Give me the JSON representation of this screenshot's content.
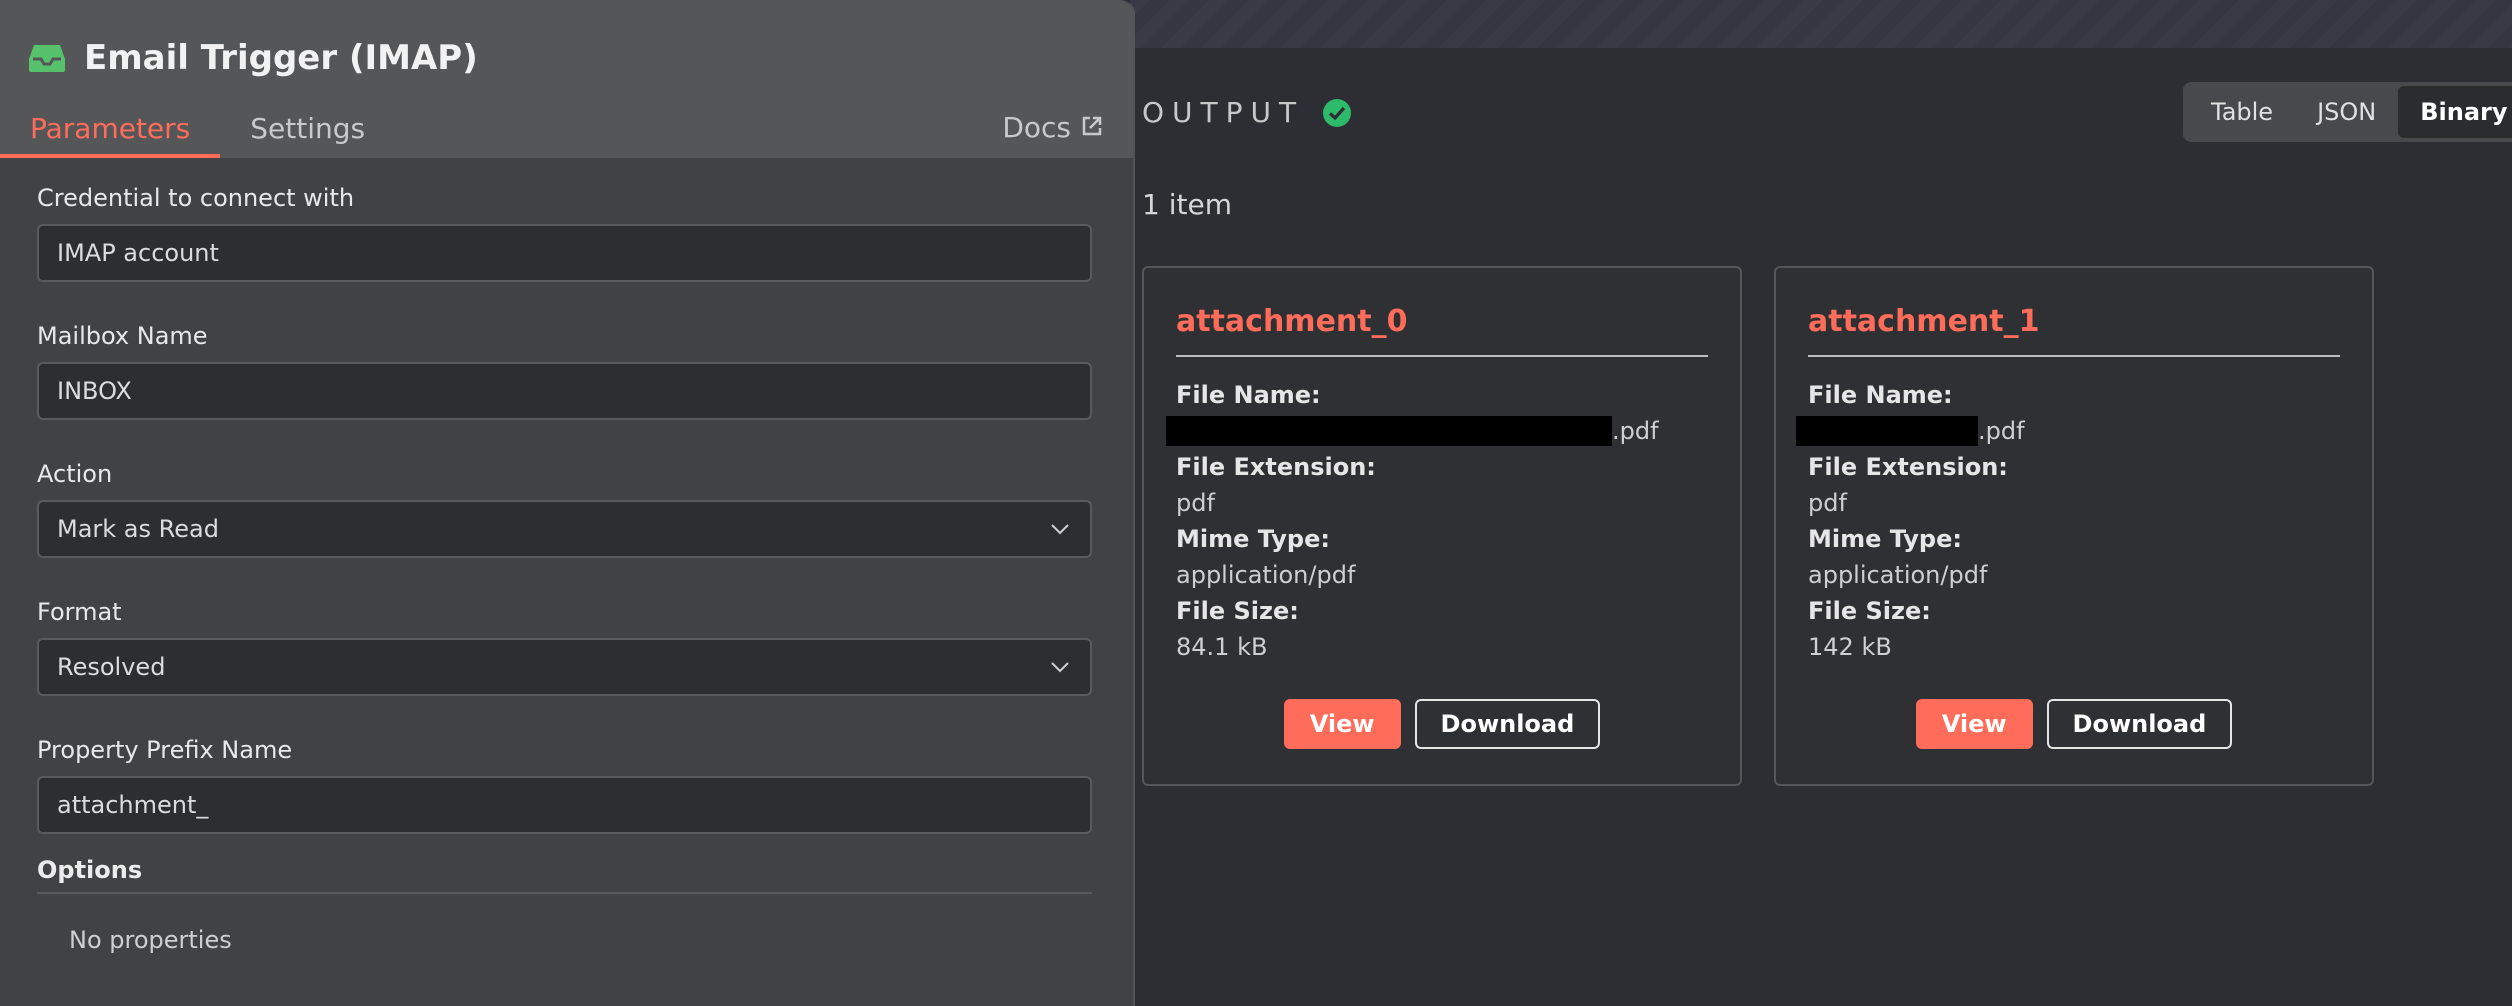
{
  "node": {
    "title": "Email Trigger (IMAP)",
    "icon": "inbox-icon",
    "accent": "#ff6d5a",
    "icon_color": "#57c26b"
  },
  "tabs": [
    {
      "label": "Parameters",
      "active": true
    },
    {
      "label": "Settings",
      "active": false
    }
  ],
  "docs_label": "Docs",
  "fields": [
    {
      "label": "Credential to connect with",
      "value": "IMAP account",
      "dropdown": false
    },
    {
      "label": "Mailbox Name",
      "value": "INBOX",
      "dropdown": false
    },
    {
      "label": "Action",
      "value": "Mark as Read",
      "dropdown": true
    },
    {
      "label": "Format",
      "value": "Resolved",
      "dropdown": true
    },
    {
      "label": "Property Prefix Name",
      "value": "attachment_",
      "dropdown": false
    }
  ],
  "options": {
    "title": "Options",
    "empty_text": "No properties"
  },
  "output": {
    "title": "OUTPUT",
    "status": "success",
    "status_color": "#2dba6a",
    "views": [
      "Table",
      "JSON",
      "Binary"
    ],
    "active_view": "Binary",
    "item_count": "1 item"
  },
  "attachments": [
    {
      "title": "attachment_0",
      "file_name_label": "File Name:",
      "file_name_suffix": ".pdf",
      "file_ext_label": "File Extension:",
      "file_ext": "pdf",
      "mime_label": "Mime Type:",
      "mime": "application/pdf",
      "size_label": "File Size:",
      "size": "84.1 kB",
      "view_label": "View",
      "download_label": "Download"
    },
    {
      "title": "attachment_1",
      "file_name_label": "File Name:",
      "file_name_suffix": ".pdf",
      "file_ext_label": "File Extension:",
      "file_ext": "pdf",
      "mime_label": "Mime Type:",
      "mime": "application/pdf",
      "size_label": "File Size:",
      "size": "142 kB",
      "view_label": "View",
      "download_label": "Download"
    }
  ]
}
